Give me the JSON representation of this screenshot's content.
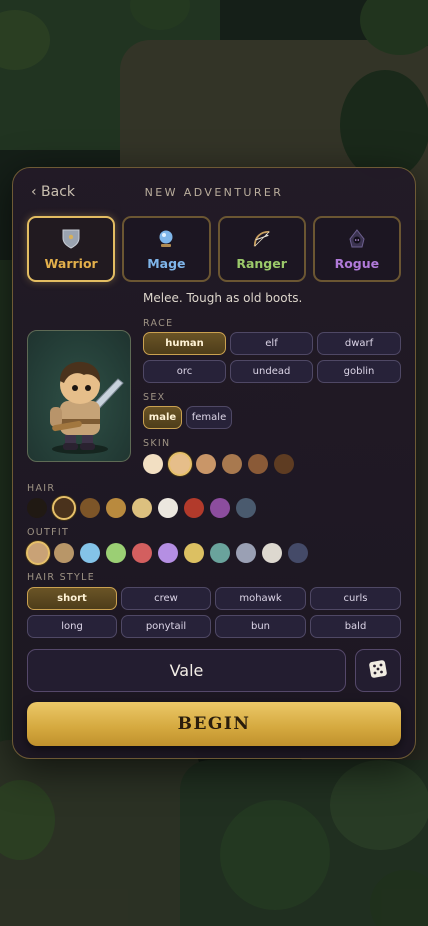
{
  "header": {
    "back_label": "‹ Back",
    "title": "NEW ADVENTURER"
  },
  "classes": [
    {
      "label": "Warrior",
      "icon": "shield-icon",
      "color": "#e3b04b",
      "selected": true
    },
    {
      "label": "Mage",
      "icon": "orb-icon",
      "color": "#7fb5ea",
      "selected": false
    },
    {
      "label": "Ranger",
      "icon": "bow-icon",
      "color": "#9bc96a",
      "selected": false
    },
    {
      "label": "Rogue",
      "icon": "hood-icon",
      "color": "#b07ad9",
      "selected": false
    }
  ],
  "description": "Melee. Tough as old boots.",
  "race": {
    "label": "RACE",
    "options": [
      "human",
      "elf",
      "dwarf",
      "orc",
      "undead",
      "goblin"
    ],
    "selected": "human"
  },
  "sex": {
    "label": "SEX",
    "options": [
      "male",
      "female"
    ],
    "selected": "male"
  },
  "skin": {
    "label": "SKIN",
    "colors": [
      "#f2dfc2",
      "#e6be8a",
      "#c99668",
      "#a8794f",
      "#8a5a37",
      "#5e3c22"
    ],
    "selected_index": 1
  },
  "hair": {
    "label": "HAIR",
    "colors": [
      "#201913",
      "#4a321c",
      "#7d5528",
      "#b98a3e",
      "#dcc07f",
      "#ece7df",
      "#b23a2b",
      "#8c4d9e",
      "#4a5a6e"
    ],
    "selected_index": 1
  },
  "outfit": {
    "label": "OUTFIT",
    "colors": [
      "#c9a276",
      "#b89668",
      "#84c3e8",
      "#9bcf74",
      "#d35f5f",
      "#b58fe3",
      "#dcc062",
      "#6aa39c",
      "#9aa0b4",
      "#ddd8cf",
      "#444a68"
    ],
    "selected_index": 0
  },
  "hair_style": {
    "label": "HAIR STYLE",
    "options": [
      "short",
      "crew",
      "mohawk",
      "curls",
      "long",
      "ponytail",
      "bun",
      "bald"
    ],
    "selected": "short"
  },
  "name_value": "Vale",
  "begin_label": "BEGIN"
}
